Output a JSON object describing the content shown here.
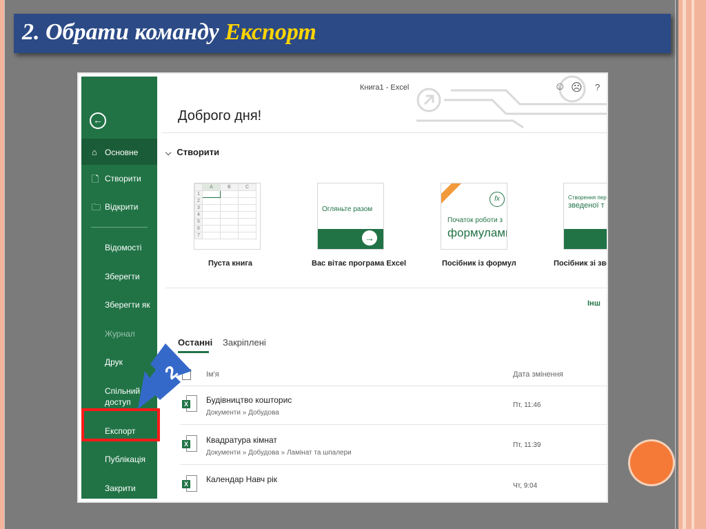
{
  "slide": {
    "title_prefix": "2.  Обрати команду ",
    "title_highlight": "Експорт",
    "colors": {
      "title_bg": "#2b4a86",
      "highlight": "#ffd400",
      "accent_circle": "#f57a38",
      "callout_box": "#ff1a1a",
      "arrow": "#3569c9"
    },
    "arrow_label": "2"
  },
  "excel": {
    "window_title": "Книга1  -  Excel",
    "faces": [
      "☺",
      "☹",
      "?"
    ],
    "sidebar": {
      "back_icon": "back-arrow-icon",
      "primary": [
        {
          "label": "Основне",
          "icon": "home-icon"
        },
        {
          "label": "Створити",
          "icon": "new-file-icon"
        },
        {
          "label": "Відкрити",
          "icon": "open-folder-icon"
        }
      ],
      "secondary": [
        {
          "label": "Відомості"
        },
        {
          "label": "Зберегти"
        },
        {
          "label": "Зберегти як"
        },
        {
          "label": "Журнал"
        },
        {
          "label": "Друк"
        },
        {
          "label": "Спільний доступ"
        },
        {
          "label": "Експорт"
        },
        {
          "label": "Публікація"
        },
        {
          "label": "Закрити"
        }
      ]
    },
    "greeting": "Доброго дня!",
    "create_header": "Створити",
    "templates": [
      {
        "label": "Пуста книга"
      },
      {
        "label": "Вас вітає програма Excel",
        "inner": "Огляньте разом"
      },
      {
        "label": "Посібник із формул",
        "inner_small": "Початок роботи з",
        "inner_big": "формулами"
      },
      {
        "label": "Посібник зі зве",
        "inner_small": "Створення пер",
        "inner_big": "зведеної т"
      }
    ],
    "grid_cols": [
      "A",
      "B",
      "C"
    ],
    "grid_rows": [
      "1",
      "2",
      "3",
      "4",
      "5",
      "6",
      "7"
    ],
    "more_link": "Інш",
    "tabs": [
      "Останні",
      "Закріплені"
    ],
    "columns": {
      "name": "Ім'я",
      "date": "Дата змінення"
    },
    "files": [
      {
        "name": "Будівництво кошторис",
        "path": "Документи » Добудова",
        "date": "Пт, 11:46"
      },
      {
        "name": "Квадратура кімнат",
        "path": "Документи » Добудова » Ламінат та шпалери",
        "date": "Пт, 11:39"
      },
      {
        "name": "Календар Навч рік",
        "path": "",
        "date": "Чт, 9:04"
      }
    ]
  }
}
